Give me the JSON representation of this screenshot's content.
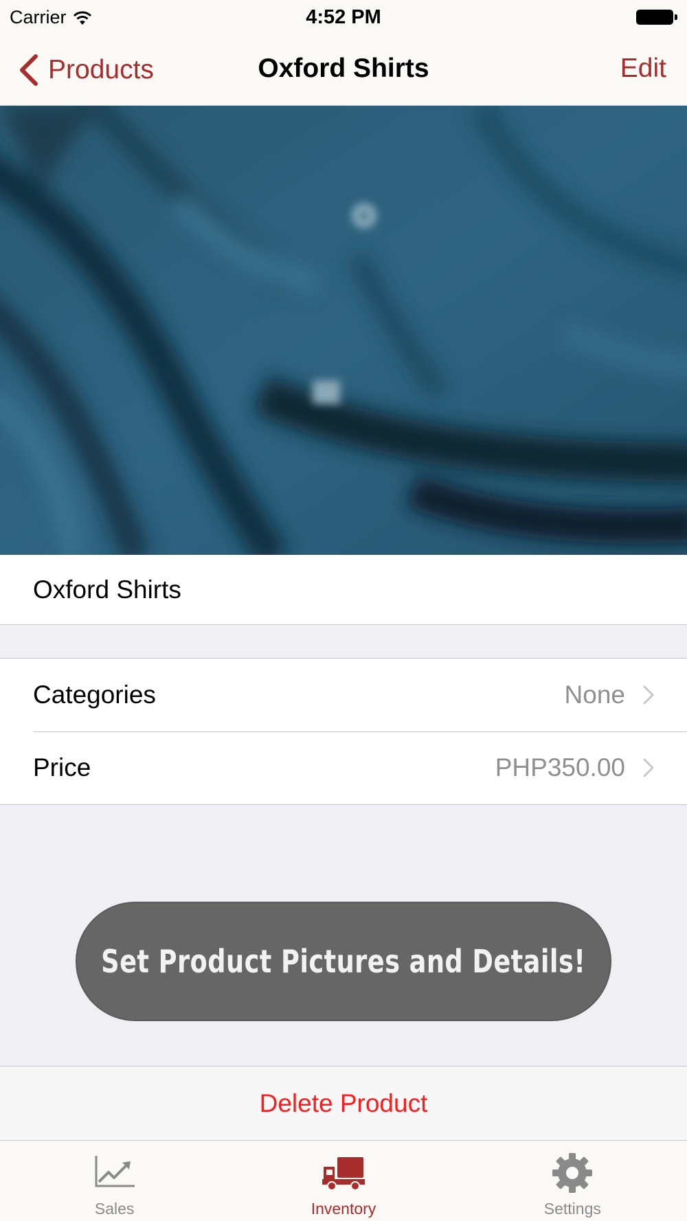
{
  "status_bar": {
    "carrier": "Carrier",
    "time": "4:52 PM"
  },
  "nav": {
    "back_label": "Products",
    "title": "Oxford Shirts",
    "edit_label": "Edit"
  },
  "product": {
    "name": "Oxford Shirts",
    "image_icon": "product-photo"
  },
  "details": [
    {
      "label": "Categories",
      "value": "None"
    },
    {
      "label": "Price",
      "value": "PHP350.00"
    }
  ],
  "toast": {
    "message": "Set Product Pictures and Details!"
  },
  "delete_label": "Delete Product",
  "tabbar": {
    "tabs": [
      {
        "label": "Sales",
        "icon": "chart-trend-icon",
        "active": false
      },
      {
        "label": "Inventory",
        "icon": "truck-icon",
        "active": true
      },
      {
        "label": "Settings",
        "icon": "gear-icon",
        "active": false
      }
    ]
  },
  "colors": {
    "accent": "#a82c2c",
    "destructive": "#fc1c1c",
    "toast_background": "#666666",
    "inactive_tab": "#8a8a8a"
  }
}
